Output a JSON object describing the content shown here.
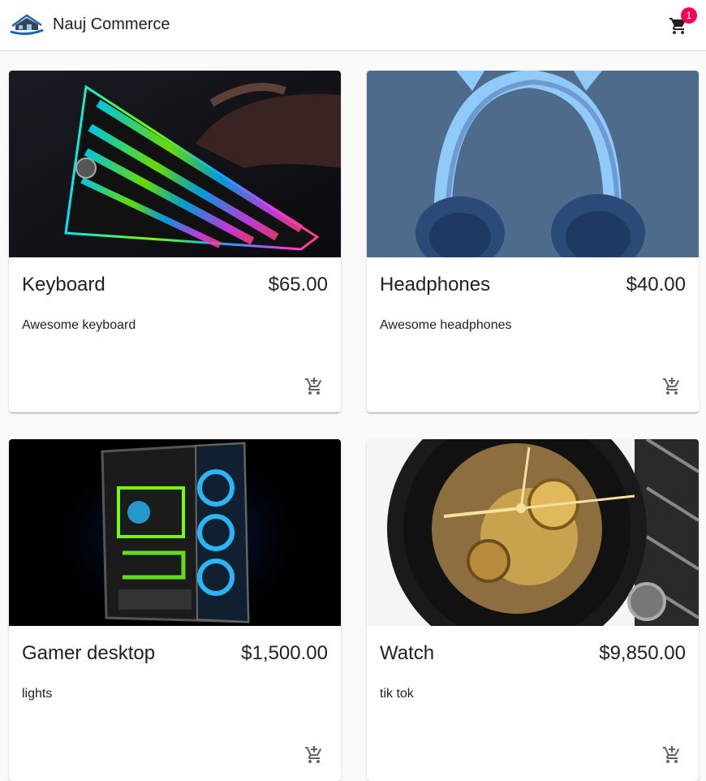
{
  "header": {
    "brand": "Nauj Commerce",
    "cart_count": "1",
    "logo_icon": "house-logo-icon",
    "cart_icon": "shopping-cart-icon"
  },
  "products": [
    {
      "name": "Keyboard",
      "price": "$65.00",
      "description": "Awesome keyboard",
      "image": "keyboard-image"
    },
    {
      "name": "Headphones",
      "price": "$40.00",
      "description": "Awesome headphones",
      "image": "headphones-image"
    },
    {
      "name": "Gamer desktop",
      "price": "$1,500.00",
      "description": "lights",
      "image": "gamer-desktop-image"
    },
    {
      "name": "Watch",
      "price": "$9,850.00",
      "description": "tik tok",
      "image": "watch-image"
    }
  ],
  "colors": {
    "accent_badge": "#f50057",
    "app_bar": "#ffffff",
    "page_background": "#fafafa",
    "icon": "#616161"
  }
}
